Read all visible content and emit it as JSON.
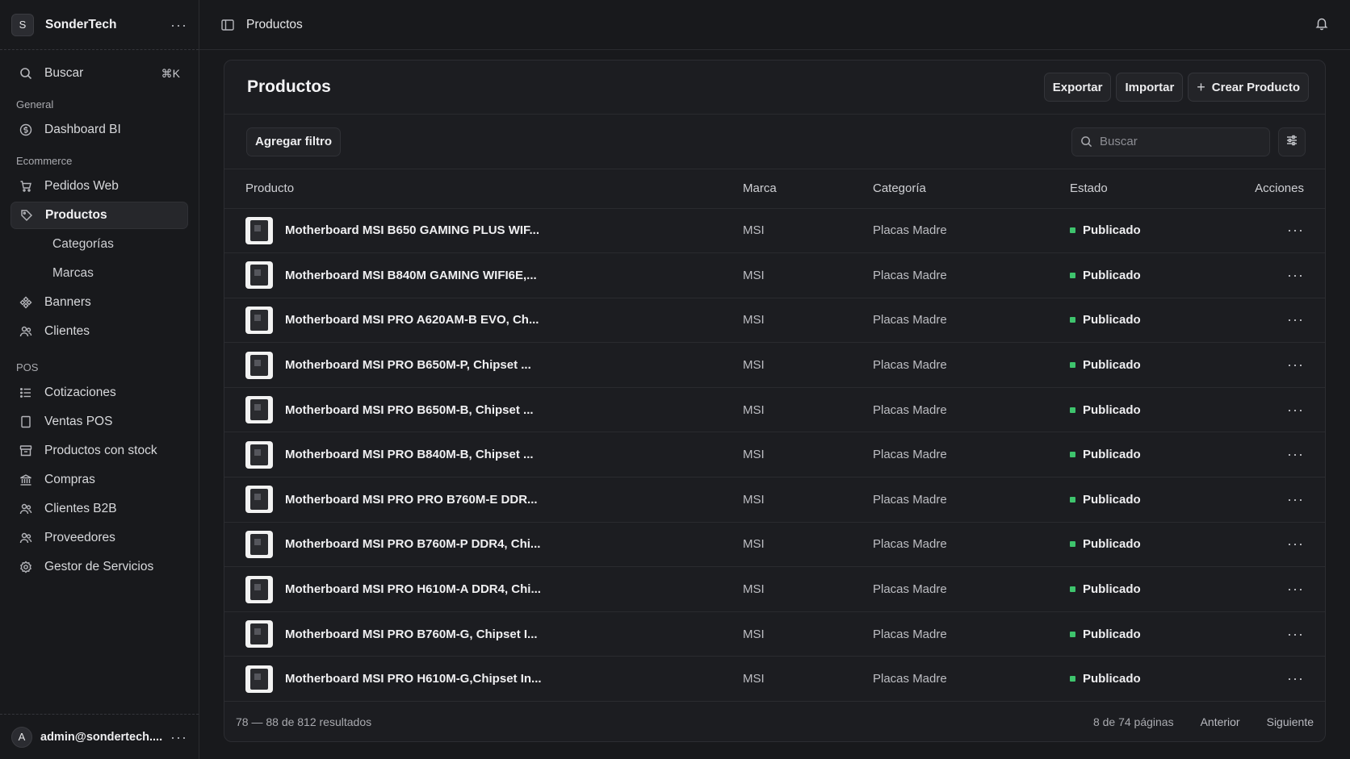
{
  "workspace": {
    "initial": "S",
    "name": "SonderTech"
  },
  "search": {
    "label": "Buscar",
    "shortcut": "⌘K"
  },
  "sections": {
    "general": "General",
    "ecommerce": "Ecommerce",
    "pos": "POS"
  },
  "nav": {
    "dashboard": "Dashboard BI",
    "pedidos": "Pedidos Web",
    "productos": "Productos",
    "categorias": "Categorías",
    "marcas": "Marcas",
    "banners": "Banners",
    "clientes": "Clientes",
    "cotizaciones": "Cotizaciones",
    "ventas": "Ventas POS",
    "stock": "Productos con stock",
    "compras": "Compras",
    "b2b": "Clientes B2B",
    "proveedores": "Proveedores",
    "servicios": "Gestor de Servicios"
  },
  "user": {
    "initial": "A",
    "email": "admin@sondertech...."
  },
  "topbar": {
    "breadcrumb": "Productos"
  },
  "panel": {
    "title": "Productos",
    "export": "Exportar",
    "import": "Importar",
    "create": "Crear Producto",
    "filter": "Agregar filtro",
    "search_placeholder": "Buscar"
  },
  "table": {
    "headers": {
      "producto": "Producto",
      "marca": "Marca",
      "categoria": "Categoría",
      "estado": "Estado",
      "acciones": "Acciones"
    },
    "rows": [
      {
        "name": "Motherboard MSI B650 GAMING PLUS WIF...",
        "marca": "MSI",
        "categoria": "Placas Madre",
        "estado": "Publicado"
      },
      {
        "name": "Motherboard MSI B840M GAMING WIFI6E,...",
        "marca": "MSI",
        "categoria": "Placas Madre",
        "estado": "Publicado"
      },
      {
        "name": "Motherboard MSI PRO A620AM-B EVO, Ch...",
        "marca": "MSI",
        "categoria": "Placas Madre",
        "estado": "Publicado"
      },
      {
        "name": "Motherboard MSI PRO B650M-P, Chipset ...",
        "marca": "MSI",
        "categoria": "Placas Madre",
        "estado": "Publicado"
      },
      {
        "name": "Motherboard MSI PRO B650M-B, Chipset ...",
        "marca": "MSI",
        "categoria": "Placas Madre",
        "estado": "Publicado"
      },
      {
        "name": "Motherboard MSI PRO B840M-B, Chipset ...",
        "marca": "MSI",
        "categoria": "Placas Madre",
        "estado": "Publicado"
      },
      {
        "name": "Motherboard MSI PRO PRO B760M-E  DDR...",
        "marca": "MSI",
        "categoria": "Placas Madre",
        "estado": "Publicado"
      },
      {
        "name": "Motherboard MSI PRO B760M-P DDR4, Chi...",
        "marca": "MSI",
        "categoria": "Placas Madre",
        "estado": "Publicado"
      },
      {
        "name": "Motherboard MSI PRO H610M-A DDR4, Chi...",
        "marca": "MSI",
        "categoria": "Placas Madre",
        "estado": "Publicado"
      },
      {
        "name": "Motherboard MSI PRO B760M-G, Chipset I...",
        "marca": "MSI",
        "categoria": "Placas Madre",
        "estado": "Publicado"
      },
      {
        "name": "Motherboard MSI PRO H610M-G,Chipset In...",
        "marca": "MSI",
        "categoria": "Placas Madre",
        "estado": "Publicado"
      }
    ]
  },
  "footer": {
    "results": "78 — 88 de 812 resultados",
    "pages": "8 de 74 páginas",
    "prev": "Anterior",
    "next": "Siguiente"
  },
  "colors": {
    "status_published": "#3ec46d",
    "background": "#18191c",
    "panel": "#1c1d21"
  },
  "icons": {
    "search": "search-icon",
    "dashboard": "dollar-circle-icon",
    "pedidos": "cart-icon",
    "productos": "tag-icon",
    "banners": "puzzle-icon",
    "clientes": "users-icon",
    "cotizaciones": "list-icon",
    "ventas": "receipt-icon",
    "stock": "archive-icon",
    "compras": "bank-icon",
    "servicios": "cog-icon",
    "bell": "bell-icon",
    "sidebar_toggle": "sidebar-icon"
  }
}
